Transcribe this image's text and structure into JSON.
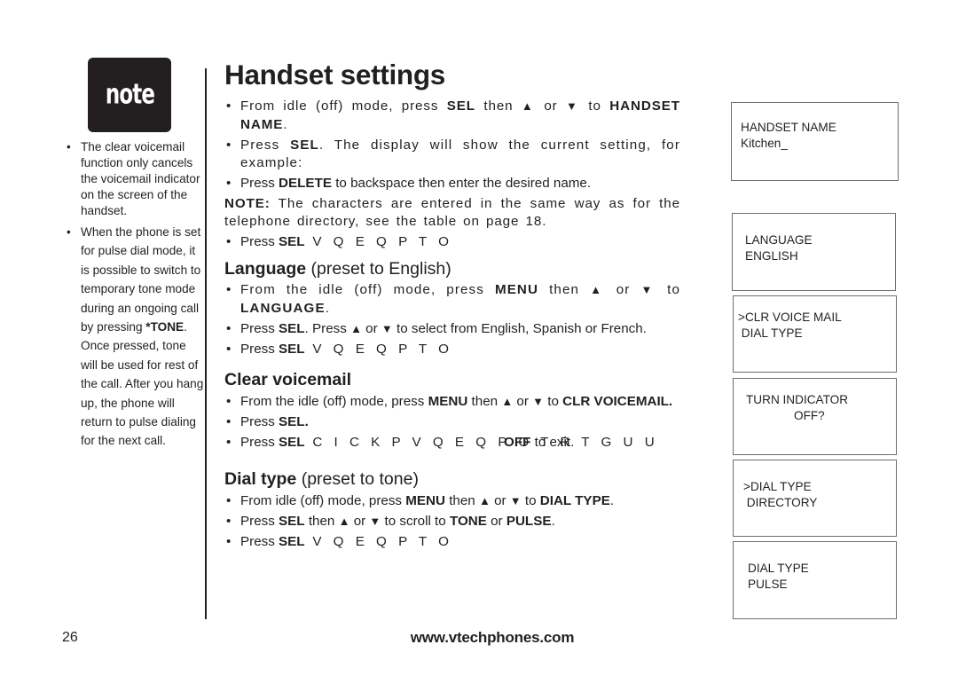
{
  "note_badge": {
    "label": "note"
  },
  "sidebar": {
    "notes": [
      "The clear voicemail function only cancels the voicemail indicator on the screen of the handset.",
      {
        "before": "When the phone is set for pulse dial mode, it is possible to switch to temporary tone mode during an ongoing call by pressing ",
        "key": "*TONE",
        "after": ". Once pressed, tone will be used for rest of the call. After you hang up, the phone will return to pulse dialing for the next call."
      }
    ]
  },
  "main": {
    "title": "Handset settings",
    "up_arrow": "▲",
    "down_arrow": "▼",
    "handset_name": {
      "step1": {
        "a": "From idle (off) mode, press ",
        "b": "SEL",
        "c": " then ",
        "d": " or ",
        "e": " to ",
        "f": "HANDSET NAME",
        "g": "."
      },
      "step2": {
        "a": "Press ",
        "b": "SEL",
        "c": ". The display will show the current setting, for example:"
      },
      "step3": {
        "a": "Press ",
        "b": "DELETE",
        "c": " to backspace then enter the desired name."
      },
      "note": {
        "label": "NOTE:",
        "text": " The characters are entered in the same way as for the telephone directory, see the table on page 18."
      },
      "step4": {
        "a": "Press ",
        "b": "SEL",
        "c": " V Q  E Q P  T O"
      }
    },
    "language": {
      "heading_bold": "Language",
      "heading_rest": " (preset to English)",
      "step1": {
        "a": "From the idle (off) mode, press ",
        "b": "MENU",
        "c": " then ",
        "d": " or ",
        "e": " to ",
        "f": "LANGUAGE",
        "g": "."
      },
      "step2": {
        "a": "Press ",
        "b": "SEL",
        "c": ". Press ",
        "d": " or ",
        "e": " to select from English, Spanish or French."
      },
      "step3": {
        "a": "Press ",
        "b": "SEL",
        "c": " V Q  E Q P  T O"
      }
    },
    "clear_voicemail": {
      "heading": "Clear voicemail",
      "step1": {
        "a": "From the idle (off) mode, press ",
        "b": "MENU",
        "c": " then  ",
        "d": "  or ",
        "e": " to ",
        "f": "CLR VOICEMAIL."
      },
      "step2": {
        "a": "Press ",
        "b": "SEL."
      },
      "step3": {
        "a": "Press ",
        "b": "SEL",
        "c": " C I C K P  V Q  E Q P  O T  R T G U U",
        "overlay_bold": "OFF",
        "overlay_rest": " to exit."
      }
    },
    "dial_type": {
      "heading_bold": "Dial type",
      "heading_rest": " (preset to tone)",
      "step1": {
        "a": "From idle (off) mode, press ",
        "b": "MENU",
        "c": " then ",
        "d": "  or ",
        "e": " to ",
        "f": "DIAL TYPE",
        "g": "."
      },
      "step2": {
        "a": "Press ",
        "b": "SEL",
        "c": " then ",
        "d": " or ",
        "e": " to scroll to ",
        "f": "TONE",
        "g": " or ",
        "h": "PULSE",
        "i": "."
      },
      "step3": {
        "a": "Press ",
        "b": "SEL",
        "c": " V Q  E Q P  T O"
      }
    }
  },
  "screens": [
    {
      "line1": "HANDSET NAME",
      "line2": "Kitchen_"
    },
    {
      "line1": "LANGUAGE",
      "line2": "ENGLISH"
    },
    {
      "line1": ">CLR VOICE MAIL",
      "line2": " DIAL TYPE"
    },
    {
      "line1": "TURN INDICATOR",
      "line2": "OFF?"
    },
    {
      "line1": ">DIAL TYPE",
      "line2": " DIRECTORY"
    },
    {
      "line1": "DIAL TYPE",
      "line2": "PULSE"
    }
  ],
  "footer": {
    "page_number": "26",
    "website": "www.vtechphones.com"
  }
}
